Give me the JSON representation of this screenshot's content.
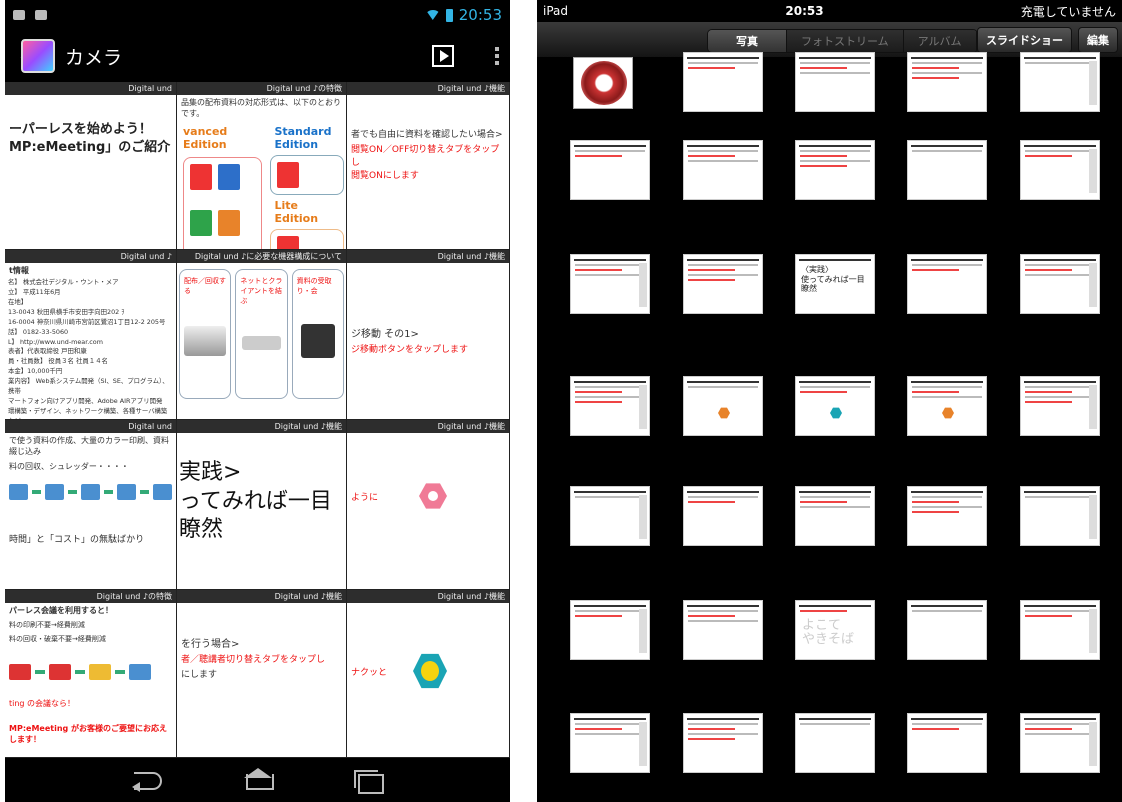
{
  "android": {
    "status": {
      "time": "20:53"
    },
    "action_bar": {
      "back_glyph": "〈",
      "title": "カメラ",
      "slideshow_icon": "play-icon",
      "menu_icon": "overflow-menu-icon"
    },
    "cells": {
      "c1": {
        "bar": "Digital und",
        "title_line1": "ーパーレスを始めよう！",
        "title_line2": "MP:eMeeting」のご紹介"
      },
      "c2": {
        "bar": "Digital und ♪の特徴",
        "intro": "品集の配布資料の対応形式は、以下のとおりです。",
        "ed_adv": "vanced Edition",
        "ed_std": "Standard Edition",
        "ed_lite": "Lite Edition",
        "pdf": "PDF",
        "word": "Word",
        "excel": "xcel",
        "ppt": "PowerPoint"
      },
      "c3": {
        "bar": "Digital und ♪機能",
        "line1": "者でも自由に資料を確認したい場合>",
        "line2": "閲覧ON／OFF切り替えタブをタップし",
        "line3": "閲覧ONにします"
      },
      "c4": {
        "bar": "Digital und ♪",
        "head": "t情報",
        "rows": [
          "名】 株式会社デジタル・ウント・メア",
          "立】 平成11年6月",
          "在地】",
          "13-0043 秋田県横手市安田字向田202 ｦ",
          "16-0004 神奈川県川崎市宮前区鷺沼1丁目12-2 205号",
          "話】 0182-33-5060",
          "L】 http://www.und-mear.com",
          "表者】代表取締役 戸田和康",
          "員・社員数】 役員３名 社員１４名",
          "本金】10,000千円",
          "業内容】 Web系システム開発（SI、SE、プログラム）、携帯",
          "マートフォン向けアプリ開発、Adobe AIRアプリ開発",
          "環構築・デザイン、ネットワーク構築、各種サーバ構築 など"
        ]
      },
      "c5": {
        "bar": "Digital und ♪に必要な機器構成について",
        "box1": "配布／回収する",
        "box2": "ネットとクライアントを結ぶ",
        "box3": "資料の受取り・会"
      },
      "c6": {
        "bar": "Digital und ♪機能",
        "line1": "ジ移動 その1>",
        "line2": "ジ移動ボタンをタップします"
      },
      "c7": {
        "bar": "Digital und",
        "lead": "で使う資料の作成、大量のカラー印刷、資料綴じ込み",
        "lead2": "料の回収、シュレッダー・・・・",
        "footer": "時間」と「コスト」の無駄ばかり"
      },
      "c8": {
        "bar": "Digital und ♪機能",
        "title_line1": "実践>",
        "title_line2": "ってみれば一目瞭然"
      },
      "c9": {
        "bar": "Digital und ♪機能",
        "label": "ように"
      },
      "c10": {
        "bar": "Digital und ♪の特徴",
        "head": "パーレス会議を利用すると！",
        "l1": "料の印刷不要→経費削減",
        "l2": "料の回収・破棄不要→経費削減",
        "l3": "ting の会議なら！",
        "footer": "MP:eMeeting がお客様のご要望にお応えします！"
      },
      "c11": {
        "bar": "Digital und ♪機能",
        "line1": "を行う場合>",
        "line2": "者／聴講者切り替えタブをタップし",
        "line3": "にします"
      },
      "c12": {
        "bar": "Digital und ♪機能",
        "label": "ナクッと"
      }
    },
    "nav": {
      "back": "back-icon",
      "home": "home-icon",
      "recent": "recent-apps-icon"
    }
  },
  "ipad": {
    "status": {
      "carrier": "iPad",
      "time": "20:53",
      "charging": "充電していません"
    },
    "toolbar": {
      "segments": [
        "写真",
        "フォトストリーム",
        "アルバム"
      ],
      "active_segment": "写真",
      "slideshow": "スライドショー",
      "edit": "編集"
    },
    "thumbs": {
      "r2c3": "〈実践〉\n使ってみれば一目瞭然",
      "r5c3": "よこて\nやきそば"
    }
  }
}
